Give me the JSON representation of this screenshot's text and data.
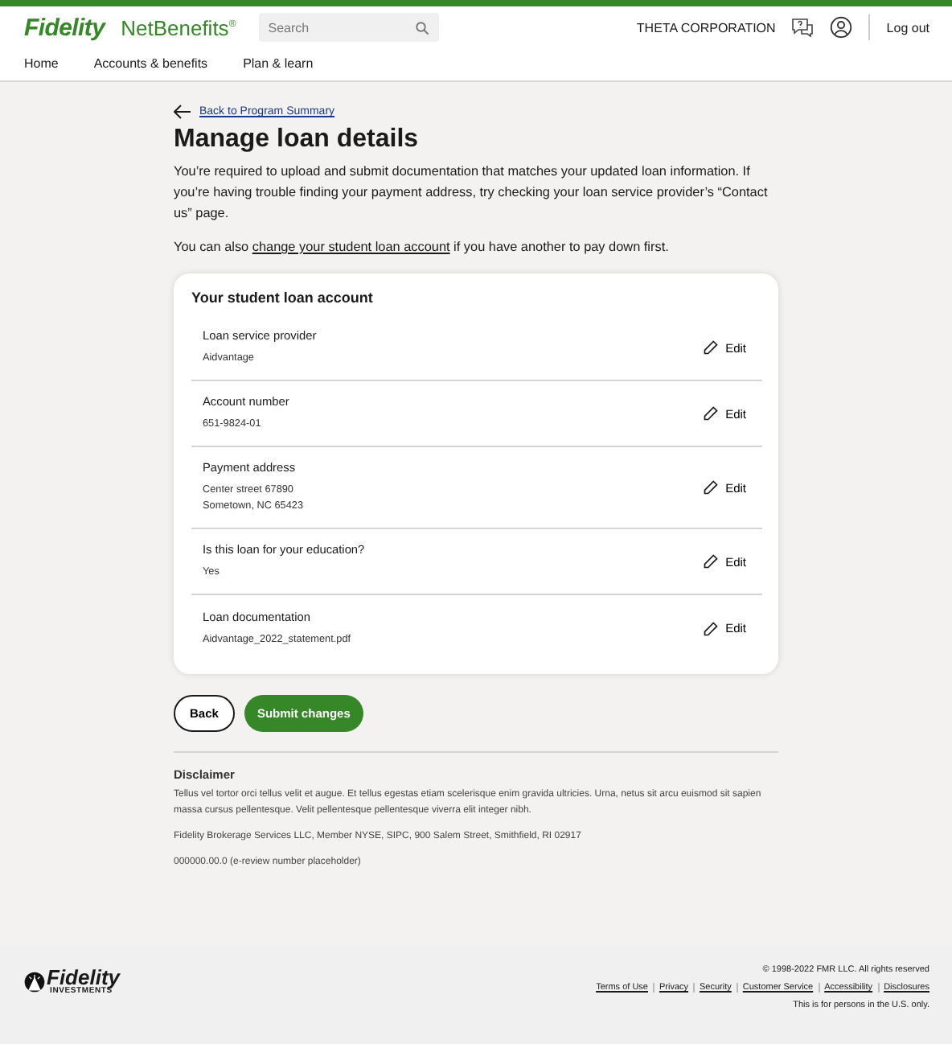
{
  "header": {
    "brand": "Fidelity",
    "product": "NetBenefits$^{®}$",
    "search": {
      "placeholder": "Search"
    },
    "company": "THETA CORPORATION",
    "logout": "Log out"
  },
  "nav": [
    "Home",
    "Accounts & benefits",
    "Plan & learn"
  ],
  "back_link": "Back to Program Summary",
  "title": "Manage loan details",
  "intro": "You’re required to upload and submit documentation that matches your updated loan information. If you’re having trouble finding your payment address, try checking your loan service provider’s “Contact us” page.",
  "change_note": {
    "before": "You can also ",
    "link": "change your student loan account",
    "after": " if you have another to pay down first."
  },
  "card": {
    "title": "Your student loan account",
    "fields": [
      {
        "label": "Loan service provider",
        "value": [
          "Aidvantage"
        ],
        "edit": "Edit"
      },
      {
        "label": "Account number",
        "value": [
          "651-9824-01"
        ],
        "edit": "Edit"
      },
      {
        "label": "Payment address",
        "value": [
          "Center street 67890",
          "Sometown, NC 65423"
        ],
        "edit": "Edit"
      },
      {
        "label": "Is this loan for your education?",
        "value": [
          "Yes"
        ],
        "edit": "Edit"
      },
      {
        "label": "Loan documentation",
        "value": [
          "Aidvantage_2022_statement.pdf"
        ],
        "edit": "Edit"
      }
    ]
  },
  "buttons": {
    "back": "Back",
    "submit": "Submit changes"
  },
  "disclaimer": {
    "title": "Disclaimer",
    "paragraphs": [
      "Tellus vel tortor orci tellus velit et augue. Et tellus egestas etiam scelerisque enim gravida ultricies. Urna, netus sit arcu euismod sit sapien massa cursus pellentesque. Velit pellentesque pellentesque viverra elit integer nibh.",
      "Fidelity Brokerage Services LLC, Member NYSE, SIPC, 900 Salem Street, Smithfield, RI 02917",
      "000000.00.0 (e-review number placeholder)"
    ]
  },
  "footer": {
    "logo": "Fidelity",
    "logo_sub": "INVESTMENTS",
    "copyright": "© 1998-2022 FMR LLC.  All rights reserved",
    "links": [
      "Terms of Use",
      "Privacy",
      "Security",
      "Customer Service",
      "Accessibility",
      "Disclosures"
    ],
    "note": "This is for persons in the U.S. only."
  }
}
